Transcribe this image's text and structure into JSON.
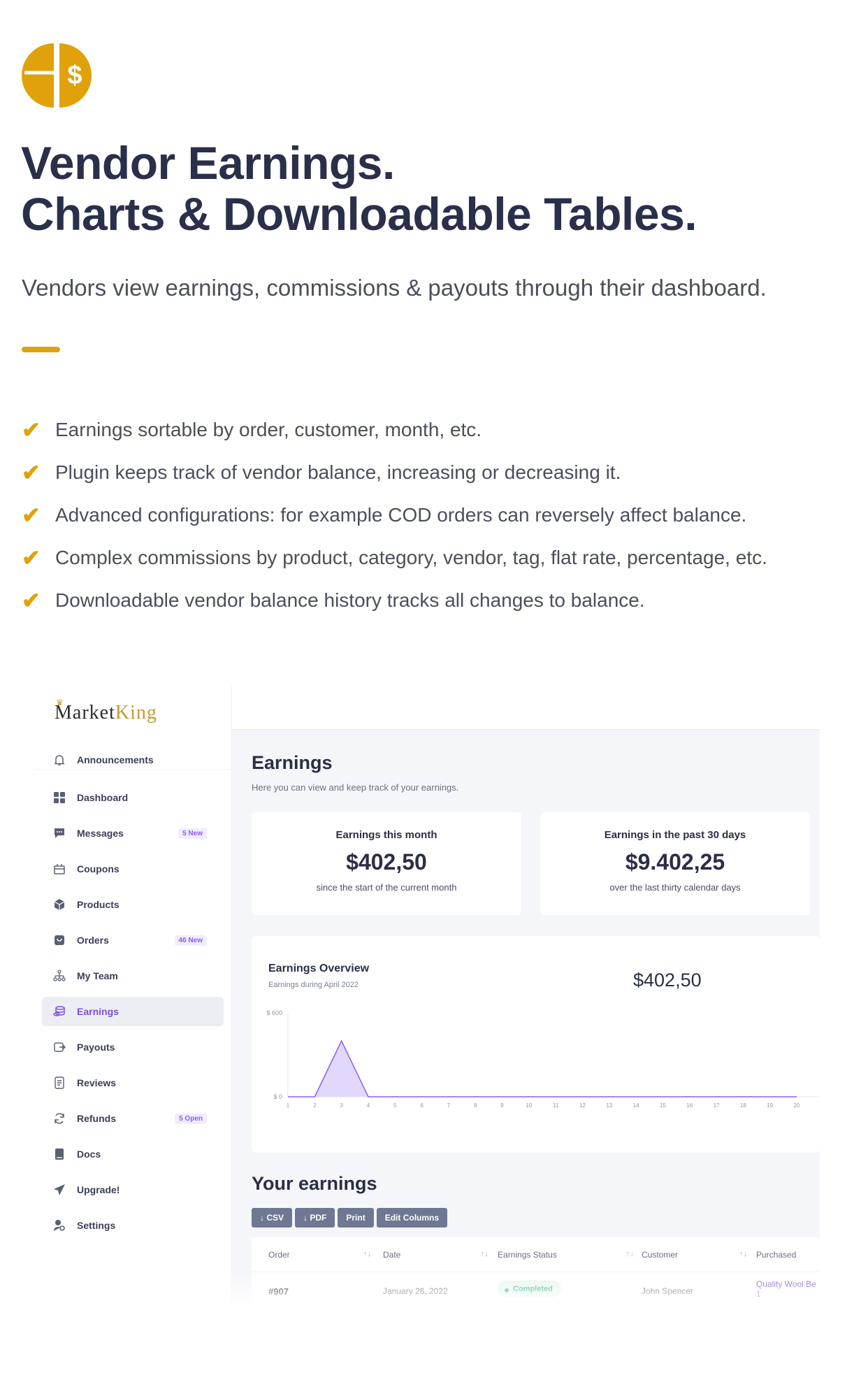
{
  "brand": {
    "accent": "#e0a10a",
    "dark": "#2a2f4a"
  },
  "headline": {
    "line1": "Vendor Earnings.",
    "line2": "Charts & Downloadable Tables."
  },
  "subtitle": "Vendors view earnings, commissions & payouts through their dashboard.",
  "features": [
    "Earnings sortable by order, customer, month, etc.",
    "Plugin keeps track of vendor balance, increasing or decreasing it.",
    "Advanced configurations: for example COD orders can reversely affect balance.",
    "Complex commissions by product, category, vendor, tag, flat rate, percentage, etc.",
    "Downloadable vendor balance history tracks all changes to balance."
  ],
  "check_glyph": "✔",
  "dashboard": {
    "logo": {
      "part1": "Market",
      "part2": "King"
    },
    "nav": [
      {
        "label": "Announcements",
        "icon": "bell-icon",
        "badge": ""
      },
      {
        "label": "Dashboard",
        "icon": "grid-icon",
        "badge": ""
      },
      {
        "label": "Messages",
        "icon": "chat-icon",
        "badge": "5 New"
      },
      {
        "label": "Coupons",
        "icon": "coupon-icon",
        "badge": ""
      },
      {
        "label": "Products",
        "icon": "box-icon",
        "badge": ""
      },
      {
        "label": "Orders",
        "icon": "cart-icon",
        "badge": "46 New"
      },
      {
        "label": "My Team",
        "icon": "team-icon",
        "badge": ""
      },
      {
        "label": "Earnings",
        "icon": "coins-icon",
        "badge": "",
        "active": true
      },
      {
        "label": "Payouts",
        "icon": "payout-icon",
        "badge": ""
      },
      {
        "label": "Reviews",
        "icon": "review-icon",
        "badge": ""
      },
      {
        "label": "Refunds",
        "icon": "refund-icon",
        "badge": "5 Open"
      },
      {
        "label": "Docs",
        "icon": "book-icon",
        "badge": ""
      },
      {
        "label": "Upgrade!",
        "icon": "send-icon",
        "badge": ""
      },
      {
        "label": "Settings",
        "icon": "settings-icon",
        "badge": ""
      }
    ],
    "page": {
      "title": "Earnings",
      "subtitle": "Here you can view and keep track of your earnings."
    },
    "stats": [
      {
        "label": "Earnings this month",
        "value": "$402,50",
        "hint": "since the start of the current month"
      },
      {
        "label": "Earnings in the past 30 days",
        "value": "$9.402,25",
        "hint": "over the last thirty calendar days"
      }
    ],
    "overview": {
      "title": "Earnings Overview",
      "subtitle": "Earnings during April 2022",
      "value": "$402,50"
    },
    "your_earnings": {
      "title": "Your earnings",
      "buttons": [
        "↓ CSV",
        "↓ PDF",
        "Print",
        "Edit Columns"
      ],
      "columns": [
        "Order",
        "Date",
        "Earnings Status",
        "Customer",
        "Purchased"
      ],
      "sort_glyph": "↑↓",
      "rows": [
        {
          "order": "#907",
          "date": "January 26, 2022",
          "status": "Completed",
          "customer": "John Spencer",
          "purchased": "Quality Wool Be",
          "purchased_qty": "1"
        }
      ]
    }
  },
  "chart_data": {
    "type": "area",
    "title": "Earnings Overview",
    "x": [
      1,
      2,
      3,
      4,
      5,
      6,
      7,
      8,
      9,
      10,
      11,
      12,
      13,
      14,
      15,
      16,
      17,
      18,
      19,
      20
    ],
    "series": [
      {
        "values": [
          0,
          0,
          400,
          0,
          0,
          0,
          0,
          0,
          0,
          0,
          0,
          0,
          0,
          0,
          0,
          0,
          0,
          0,
          0,
          0
        ]
      }
    ],
    "y_tick_labels": [
      "$ 600",
      "$ 0"
    ],
    "ylim": [
      0,
      600
    ],
    "xlim": [
      1,
      20
    ],
    "colors": {
      "line": "#8b5cf6",
      "fill": "#e2d8fb"
    },
    "grid": false
  }
}
